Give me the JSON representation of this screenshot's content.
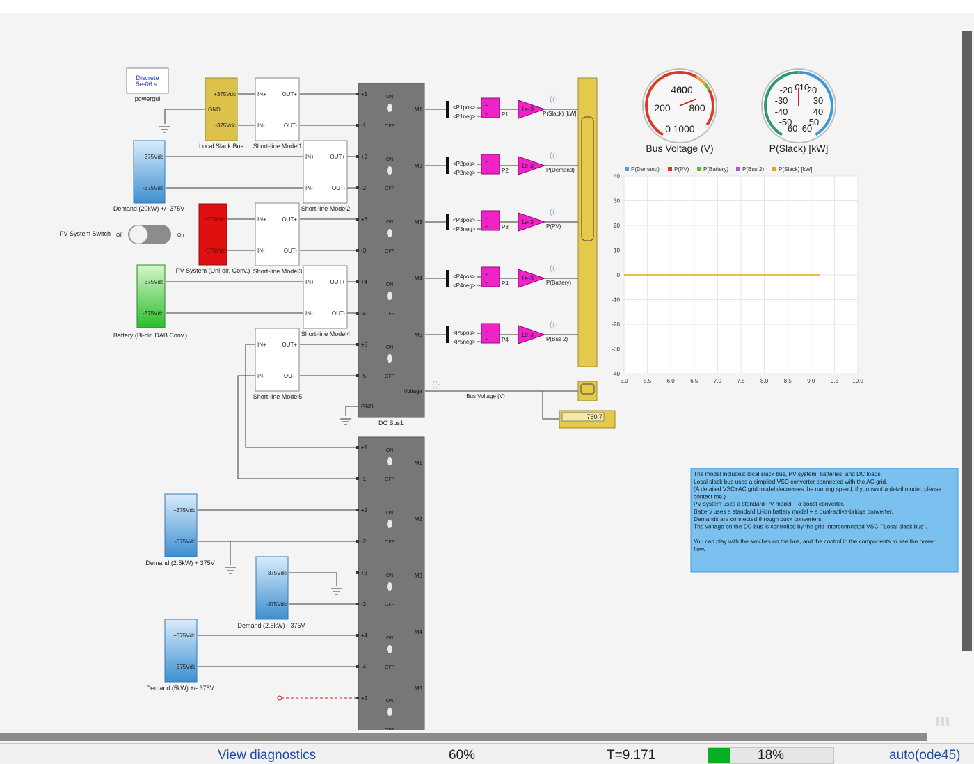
{
  "diagram": {
    "powergui": {
      "line1": "Discrete",
      "line2": "5e-06 s.",
      "name": "powergui"
    },
    "local_slack": {
      "pos": "+375Vdc",
      "gnd": "GND",
      "neg": "-375Vdc",
      "name": "Local Slack Bus"
    },
    "demand_20": {
      "pos": "+375Vdc",
      "neg": "-375Vdc",
      "name": "Demand (20kW) +/- 375V"
    },
    "pv_switch": {
      "label": "PV System Switch",
      "off": "Off",
      "on": "On"
    },
    "pv_system": {
      "pos": "+375Vdc",
      "neg": "-375Vdc",
      "name": "PV System (Uni-dir. Conv.)"
    },
    "battery": {
      "pos": "+375Vdc",
      "neg": "-375Vdc",
      "name": "Battery (Bi-dir. DAB Conv.)"
    },
    "line_port_labels": {
      "in_p": "IN+",
      "in_n": "IN-",
      "out_p": "OUT+",
      "out_n": "OUT-"
    },
    "short_lines": [
      "Short-line Model1",
      "Short-line Model2",
      "Short-line Model3",
      "Short-line Model4",
      "Short-line Model5"
    ],
    "bus_switch": {
      "on": "ON",
      "off": "OFF"
    },
    "dc_bus1": {
      "name": "DC Bus1",
      "ports": [
        "+1",
        "-1",
        "+2",
        "-2",
        "+3",
        "-3",
        "+4",
        "-4",
        "+5",
        "-5"
      ],
      "outputs": [
        "M1",
        "M2",
        "M3",
        "M4",
        "M5"
      ],
      "voltage": "Voltage",
      "gnd": "GND"
    },
    "dc_bus2": {
      "ports": [
        "+1",
        "-1",
        "+2",
        "-2",
        "+3",
        "-3",
        "+4",
        "-4",
        "+5"
      ],
      "outputs": [
        "M1",
        "M2",
        "M3",
        "M4",
        "M5"
      ]
    },
    "demand_small": [
      {
        "pos": "+375Vdc",
        "neg": "-375Vdc",
        "name": "Demand (2.5kW) + 375V"
      },
      {
        "pos": "+375Vdc",
        "neg": "-375Vdc",
        "name": "Demand (2.5kW) - 375V"
      },
      {
        "pos": "+375Vdc",
        "neg": "-375Vdc",
        "name": "Demand (5kW) +/- 375V"
      }
    ],
    "rows": [
      {
        "bus_pos": "<P1pos>",
        "bus_neg": "<P1neg>",
        "sum": "P1",
        "gain": "1e-3",
        "signal": "P(Slack) [kW]"
      },
      {
        "bus_pos": "<P2pos>",
        "bus_neg": "<P2neg>",
        "sum": "P2",
        "gain": "1e-3",
        "signal": "P(Demand)"
      },
      {
        "bus_pos": "<P3pos>",
        "bus_neg": "<P3neg>",
        "sum": "P3",
        "gain": "1e-3",
        "signal": "P(PV)"
      },
      {
        "bus_pos": "<P4pos>",
        "bus_neg": "<P4neg>",
        "sum": "P4",
        "gain": "1e-3",
        "signal": "P(Battery)"
      },
      {
        "bus_pos": "<P5pos>",
        "bus_neg": "<P5neg>",
        "sum": "P4",
        "gain": "1e-3",
        "signal": "P(Bus 2)"
      }
    ],
    "bus_voltage_signal": "Bus Voltage (V)",
    "display_value": "750.7",
    "gauges": [
      {
        "title": "Bus Voltage (V)",
        "ticks": [
          "400",
          "600",
          "200",
          "800",
          "0",
          "1000"
        ],
        "value": 750.7,
        "min": 0,
        "max": 1000
      },
      {
        "title": "P(Slack) [kW]",
        "ticks": [
          "-20",
          "0",
          "10",
          "20",
          "-30",
          "30",
          "-40",
          "40",
          "-50",
          "50",
          "-60",
          "60"
        ],
        "value": 0,
        "min": -60,
        "max": 60
      }
    ],
    "note_lines": [
      "The model includes: local slack bus, PV system, batteries, and DC loads.",
      "Local slack bus uses a simplied VSC converter connected with the AC grid.",
      "(A detailed VSC+AC grid model decreases the running speed, if you want a detail model, please",
      "contact me.)",
      "PV system uses a standard PV model + a boost converter.",
      "Battery uses a standard Li-ion battery model + a dual-active-bridge converter.",
      "Demands are connected through buck converters.",
      "The voltage on the DC bus is controlled by the grid-interconnected VSC, \"Local slack bus\".",
      "",
      "You can play with the swiches on the bus, and the control in the components to see the power",
      "flow."
    ]
  },
  "chart_data": {
    "type": "line",
    "legend": [
      {
        "name": "P(Demand)",
        "color": "#4aa3df"
      },
      {
        "name": "P(PV)",
        "color": "#d9392b"
      },
      {
        "name": "P(Battery)",
        "color": "#5cbf2a"
      },
      {
        "name": "P(Bus 2)",
        "color": "#a45bd8"
      },
      {
        "name": "P(Slack) [kW]",
        "color": "#eba51a"
      }
    ],
    "x_ticks": [
      "5.0",
      "5.5",
      "6.0",
      "6.5",
      "7.0",
      "7.5",
      "8.0",
      "8.5",
      "9.0",
      "9.5",
      "10.0"
    ],
    "y_ticks": [
      "40",
      "30",
      "20",
      "10",
      "0",
      "-10",
      "-20",
      "-30",
      "-40"
    ],
    "xlim": [
      5.0,
      10.0
    ],
    "ylim": [
      -40,
      40
    ],
    "grid": true,
    "legend_position": "top",
    "series": [
      {
        "name": "P(Slack) [kW]",
        "x": [
          5.0,
          9.2
        ],
        "y": [
          0,
          0
        ]
      }
    ]
  },
  "status": {
    "diagnostics": "View diagnostics",
    "zoom": "60%",
    "time": "T=9.171",
    "progress_text": "18%",
    "progress": 0.18,
    "solver": "auto(ode45)"
  }
}
